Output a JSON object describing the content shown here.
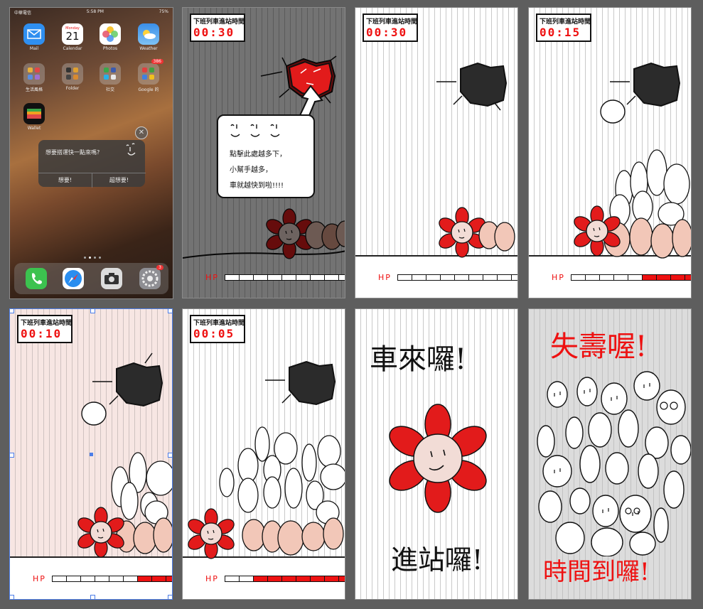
{
  "phone": {
    "carrier": "中華電信",
    "time": "5:58 PM",
    "battery": "75%",
    "apps": [
      {
        "name": "Mail",
        "icon": "mail-icon"
      },
      {
        "name": "Calendar",
        "icon": "calendar-icon",
        "weekday": "Monday",
        "day": "21"
      },
      {
        "name": "Photos",
        "icon": "photos-icon"
      },
      {
        "name": "Weather",
        "icon": "weather-icon"
      },
      {
        "name": "生活風格",
        "icon": "folder-icon"
      },
      {
        "name": "Folder",
        "icon": "folder-icon"
      },
      {
        "name": "社交",
        "icon": "folder-icon"
      },
      {
        "name": "Google 的",
        "icon": "folder-icon",
        "badge": "386"
      },
      {
        "name": "Wallet",
        "icon": "wallet-icon"
      }
    ],
    "alert": {
      "message": "想要搭運快一點來嗎?",
      "button_left": "想要!",
      "button_right": "超想要!"
    },
    "dock_badge": "3"
  },
  "panels": [
    {
      "timer_label": "下班列車進站時間",
      "timer_value": "00:30",
      "hp_on": 1
    },
    {
      "timer_label": "下班列車進站時間",
      "timer_value": "00:30",
      "hp_on": 1
    },
    {
      "timer_label": "下班列車進站時間",
      "timer_value": "00:15",
      "hp_on": 5
    },
    {
      "timer_label": "下班列車進站時間",
      "timer_value": "00:10",
      "hp_on": 4
    },
    {
      "timer_label": "下班列車進站時間",
      "timer_value": "00:05",
      "hp_on": 8
    }
  ],
  "hp_label": "HP",
  "tutorial": {
    "line1": "點擊此處越多下，",
    "line2": "小幫手越多，",
    "line3": "車就越快到啦!!!!"
  },
  "arrive": {
    "top": "車來囉!",
    "bottom": "進站囉!"
  },
  "fail": {
    "top": "失壽喔!",
    "bottom": "時間到囉!"
  },
  "colors": {
    "accent": "#e11111",
    "face_red": "#e21b1b"
  }
}
